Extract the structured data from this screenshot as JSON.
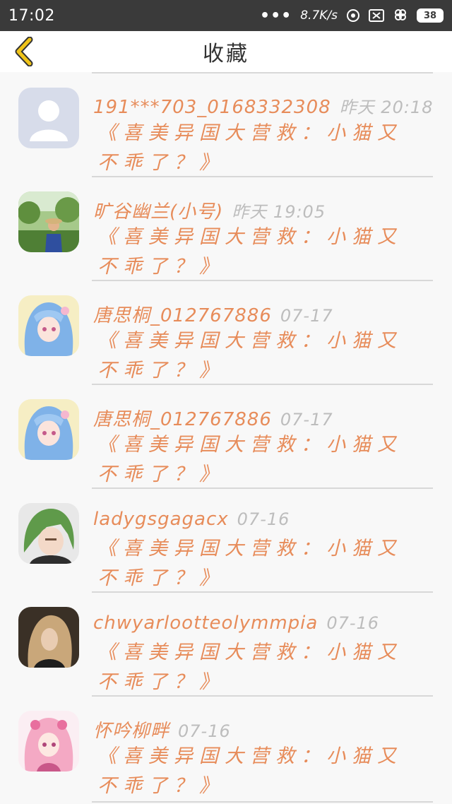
{
  "status": {
    "time": "17:02",
    "dots": "•••",
    "speed": "8.7K/s",
    "battery": "38"
  },
  "header": {
    "title": "收藏"
  },
  "items": [
    {
      "user": "191***703_0168332308",
      "time": "昨天 20:18",
      "message": "《喜美异国大营救：小猫又不乖了？》"
    },
    {
      "user": "旷谷幽兰(小号)",
      "time": "昨天 19:05",
      "message": "《喜美异国大营救：小猫又不乖了？》"
    },
    {
      "user": "唐思桐_012767886",
      "time": "07-17",
      "message": "《喜美异国大营救：小猫又不乖了？》"
    },
    {
      "user": "唐思桐_012767886",
      "time": "07-17",
      "message": "《喜美异国大营救：小猫又不乖了？》"
    },
    {
      "user": "ladygsgagacx",
      "time": "07-16",
      "message": "《喜美异国大营救：小猫又不乖了？》"
    },
    {
      "user": "chwyarlootteolymmpia",
      "time": "07-16",
      "message": "《喜美异国大营救：小猫又不乖了？》"
    },
    {
      "user": "怀吟柳畔",
      "time": "07-16",
      "message": "《喜美异国大营救：小猫又不乖了？》"
    }
  ],
  "colors": {
    "accent": "#e78c5a",
    "time": "#bdbdbd",
    "statusbar": "#3a3a3a",
    "back_arrow": "#f0c419"
  },
  "icons": {
    "back": "chevron-left-icon",
    "avatar_default": "default-avatar-icon"
  }
}
